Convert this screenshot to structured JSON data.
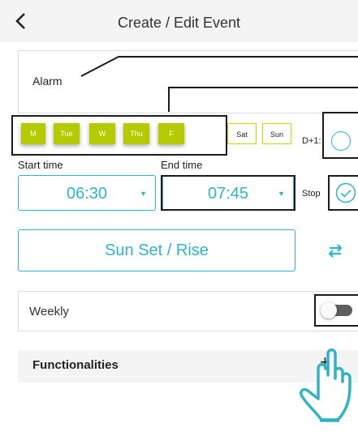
{
  "header": {
    "title": "Create / Edit Event"
  },
  "event": {
    "name": "Alarm"
  },
  "days": [
    {
      "label": "M",
      "on": true
    },
    {
      "label": "Tue",
      "on": true
    },
    {
      "label": "W",
      "on": true
    },
    {
      "label": "Thu",
      "on": true
    },
    {
      "label": "F",
      "on": true
    },
    {
      "label": "Sat",
      "on": false
    },
    {
      "label": "Sun",
      "on": false
    }
  ],
  "options": {
    "dplus_label": "D+1:",
    "stop_label": "Stop",
    "stop_checked": true,
    "dplus_checked": false
  },
  "start": {
    "label": "Start time",
    "value": "06:30"
  },
  "end": {
    "label": "End time",
    "value": "07:45"
  },
  "sun": {
    "label": "Sun Set / Rise"
  },
  "weekly": {
    "label": "Weekly",
    "enabled": false
  },
  "functionalities": {
    "label": "Functionalities",
    "add_symbol": "+"
  },
  "colors": {
    "accent": "#2fb4c4",
    "day_active": "#b5cb00",
    "day_inactive_border": "#c8d400"
  }
}
